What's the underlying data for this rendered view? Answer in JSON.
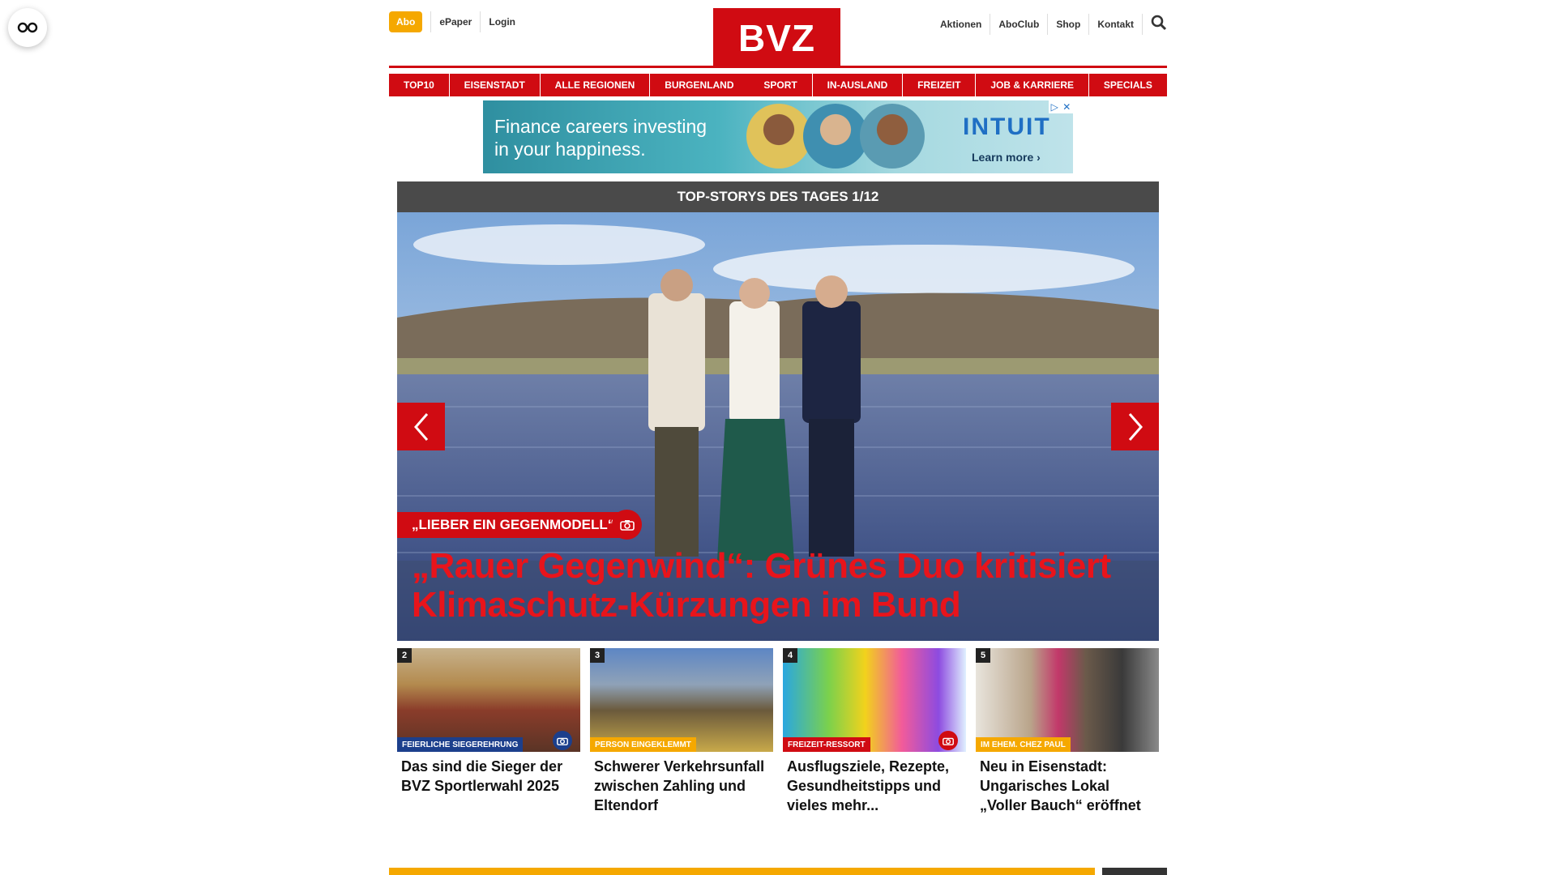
{
  "reader": {
    "icon": "glasses-icon"
  },
  "header": {
    "abo": "Abo",
    "left_links": [
      "ePaper",
      "Login"
    ],
    "logo": "BVZ",
    "right_links": [
      "Aktionen",
      "AboClub",
      "Shop",
      "Kontakt"
    ],
    "search_icon": "search-icon"
  },
  "nav": [
    "TOP10",
    "EISENSTADT",
    "ALLE REGIONEN",
    "BURGENLAND",
    "SPORT",
    "IN-AUSLAND",
    "FREIZEIT",
    "JOB & KARRIERE",
    "SPECIALS"
  ],
  "ad": {
    "text_line1": "Finance careers investing",
    "text_line2": "in your happiness.",
    "brand": "INTUIT",
    "cta": "Learn more ›"
  },
  "hero": {
    "heading": "TOP-STORYS DES TAGES 1/12",
    "kicker": "„LIEBER EIN GEGENMODELL“",
    "title": "„Rauer Gegenwind“: Grünes Duo kritisiert Klimaschutz-Kürzungen im Bund"
  },
  "cards": [
    {
      "num": "2",
      "tag": "FEIERLICHE SIEGEREHRUNG",
      "tag_color": "#1c3f8c",
      "title": "Das sind die Sieger der BVZ Sportlerwahl 2025",
      "has_camera": true,
      "camera_color": "#1c3f8c"
    },
    {
      "num": "3",
      "tag": "PERSON EINGEKLEMMT",
      "tag_color": "#f5a800",
      "title": "Schwerer Verkehrsunfall zwischen Zahling und Eltendorf",
      "has_camera": false,
      "camera_color": ""
    },
    {
      "num": "4",
      "tag": "FREIZEIT-RESSORT",
      "tag_color": "#d00b12",
      "title": "Ausflugsziele, Rezepte, Gesundheitstipps und vieles mehr...",
      "has_camera": true,
      "camera_color": "#d00b12"
    },
    {
      "num": "5",
      "tag": "IM EHEM. CHEZ PAUL",
      "tag_color": "#f5a800",
      "title": "Neu in Eisenstadt: Ungarisches Lokal „Voller Bauch“ eröffnet",
      "has_camera": false,
      "camera_color": ""
    }
  ],
  "colors": {
    "brand_red": "#d00b12",
    "accent_yellow": "#f5a800",
    "hero_title_red": "#e8141b"
  }
}
